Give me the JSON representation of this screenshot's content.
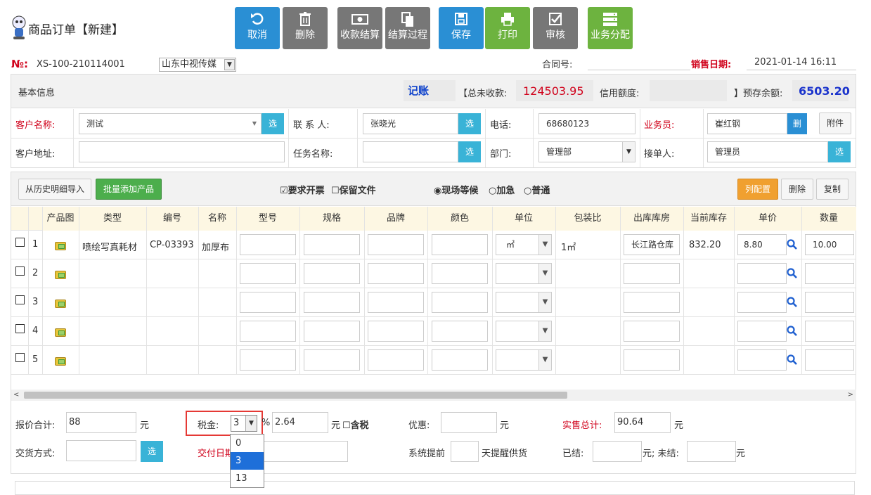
{
  "app": {
    "title": "商品订单【新建】"
  },
  "toolbar": [
    {
      "label": "取消",
      "icon": "undo-icon",
      "color": "#2a8fd4"
    },
    {
      "label": "删除",
      "icon": "trash-icon",
      "color": "#777777"
    },
    {
      "label": "收款结算",
      "icon": "money-icon",
      "color": "#777777"
    },
    {
      "label": "结算过程",
      "icon": "copy-icon",
      "color": "#777777"
    },
    {
      "label": "保存",
      "icon": "save-icon",
      "color": "#2a8fd4"
    },
    {
      "label": "打印",
      "icon": "print-icon",
      "color": "#6db33f"
    },
    {
      "label": "审核",
      "icon": "check-icon",
      "color": "#777777"
    },
    {
      "label": "业务分配",
      "icon": "server-icon",
      "color": "#6db33f"
    }
  ],
  "order": {
    "no_label": "№:",
    "no": "XS-100-210114001",
    "company": "山东中视传媒",
    "contract_label": "合同号:",
    "contract": "",
    "date_label": "销售日期:",
    "date": "2021-01-14 16:11"
  },
  "info": {
    "title": "基本信息",
    "bookkeep": "记账",
    "unpaid_label": "【总未收款:",
    "unpaid": "124503.95",
    "credit_label": "信用额度:",
    "credit": "",
    "balance_label": "】预存余额:",
    "balance": "6503.20"
  },
  "form": {
    "customer_label": "客户名称:",
    "customer": "测试",
    "select": "选",
    "contact_label": "联 系 人:",
    "contact": "张晓光",
    "phone_label": "电话:",
    "phone": "68680123",
    "sales_label": "业务员:",
    "sales": "崔红钢",
    "del": "删",
    "attach": "附件",
    "address_label": "客户地址:",
    "address": "",
    "task_label": "任务名称:",
    "task": "",
    "dept_label": "部门:",
    "dept": "管理部",
    "receiver_label": "接单人:",
    "receiver": "管理员"
  },
  "actions": {
    "import": "从历史明细导入",
    "batch": "批量添加产品",
    "invoice": "要求开票",
    "keepfile": "保留文件",
    "priority": [
      "现场等候",
      "加急",
      "普通"
    ],
    "colcfg": "列配置",
    "delete": "删除",
    "copy": "复制"
  },
  "table": {
    "headers": [
      "产品图",
      "类型",
      "编号",
      "名称",
      "型号",
      "规格",
      "品牌",
      "颜色",
      "单位",
      "包装比",
      "出库库房",
      "当前库存",
      "单价",
      "数量"
    ],
    "rows": [
      {
        "no": "1",
        "type": "喷绘写真耗材",
        "code": "CP-03393",
        "name": "加厚布",
        "unit": "㎡",
        "ratio": "1㎡",
        "warehouse": "长江路仓库",
        "stock": "832.20",
        "price": "8.80",
        "qty": "10.00"
      },
      {
        "no": "2"
      },
      {
        "no": "3"
      },
      {
        "no": "4"
      },
      {
        "no": "5"
      }
    ]
  },
  "footer": {
    "quote_label": "报价合计:",
    "quote": "88",
    "yuan": "元",
    "tax_label": "税金:",
    "tax": "3",
    "percent": "%",
    "tax_amount": "2.64",
    "incl_tax": "含税",
    "discount_label": "优惠:",
    "discount": "",
    "total_label": "实售总计:",
    "total": "90.64",
    "delivery_label": "交货方式:",
    "delivery": "",
    "select": "选",
    "due_label": "交付日期",
    "remind_label": "系统提前",
    "remind_days": "",
    "remind_suffix": "天提醒供货",
    "settled_label": "已结:",
    "settled_suffix": "元; 未结:",
    "tax_options": [
      "0",
      "3",
      "13"
    ]
  }
}
